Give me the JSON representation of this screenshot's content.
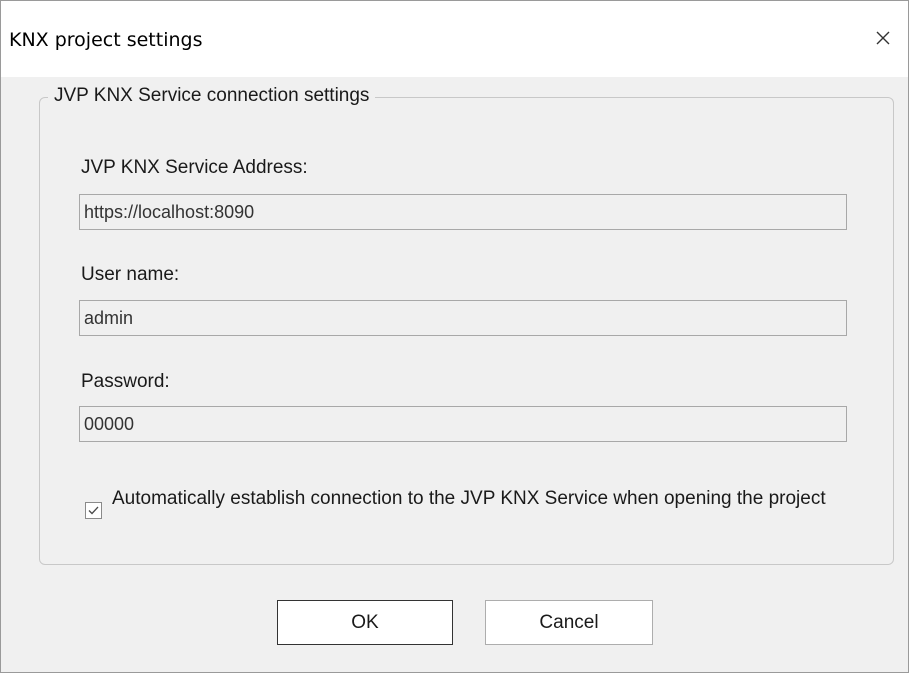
{
  "window": {
    "title": "KNX project settings",
    "close_icon": "close-icon"
  },
  "group": {
    "legend": "JVP KNX Service connection settings"
  },
  "fields": {
    "address": {
      "label": "JVP KNX Service Address:",
      "value": "https://localhost:8090"
    },
    "username": {
      "label": "User name:",
      "value": "admin"
    },
    "password": {
      "label": "Password:",
      "value": "00000"
    }
  },
  "auto_connect": {
    "checked": true,
    "label": "Automatically establish connection to the JVP KNX Service when opening the project"
  },
  "buttons": {
    "ok": "OK",
    "cancel": "Cancel"
  },
  "colors": {
    "titlebar_bg": "#ffffff",
    "dialog_bg": "#f0f0f0",
    "border": "#a8a8a8"
  }
}
